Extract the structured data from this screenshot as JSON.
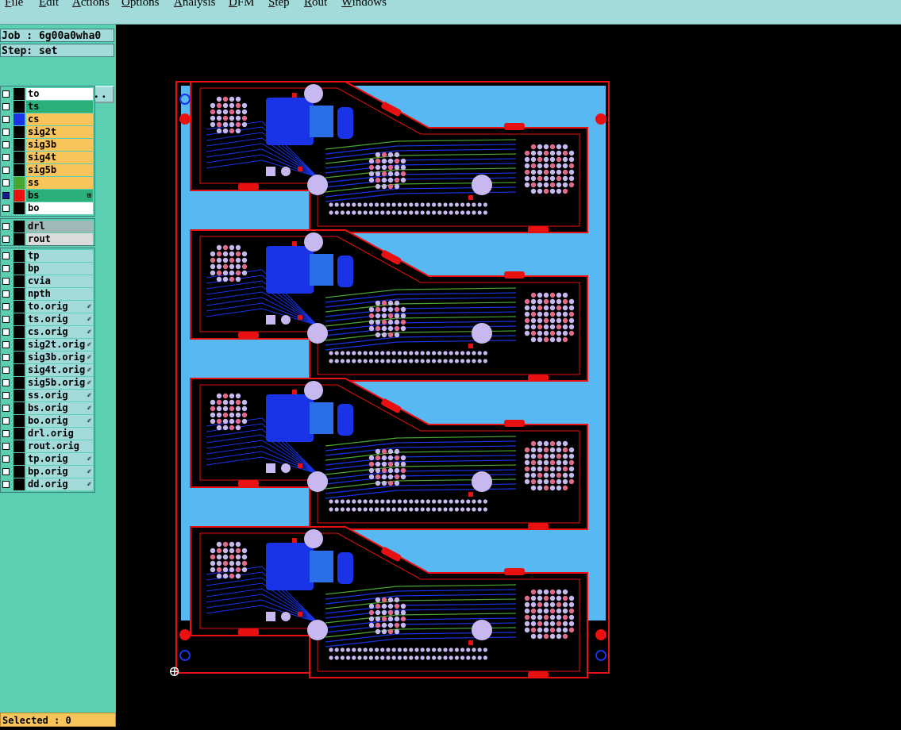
{
  "menu": [
    "File",
    "Edit",
    "Actions",
    "Options",
    "Analysis",
    "DFM",
    "Step",
    "Rout",
    "Windows"
  ],
  "job_label": "Job : 6g00a0wha0",
  "step_label": "Step: set",
  "job_matrix_button": "Job Matrix ...",
  "layers_main": [
    {
      "name": "to",
      "bg": "#ffffff",
      "swatch": "#000000",
      "mark": ""
    },
    {
      "name": "ts",
      "bg": "#2bb07a",
      "swatch": "#000000",
      "mark": ""
    },
    {
      "name": "cs",
      "bg": "#f9c45a",
      "swatch": "#1a33e6",
      "mark": ""
    },
    {
      "name": "sig2t",
      "bg": "#f9c45a",
      "swatch": "#000000",
      "mark": ""
    },
    {
      "name": "sig3b",
      "bg": "#f9c45a",
      "swatch": "#000000",
      "mark": ""
    },
    {
      "name": "sig4t",
      "bg": "#f9c45a",
      "swatch": "#000000",
      "mark": ""
    },
    {
      "name": "sig5b",
      "bg": "#f9c45a",
      "swatch": "#000000",
      "mark": ""
    },
    {
      "name": "ss",
      "bg": "#f9c45a",
      "swatch": "#47a530",
      "mark": ""
    },
    {
      "name": "bs",
      "bg": "#2bb07a",
      "swatch": "#e81010",
      "mark": "⊞"
    },
    {
      "name": "bo",
      "bg": "#ffffff",
      "swatch": "#000000",
      "mark": ""
    }
  ],
  "layers_drill": [
    {
      "name": "drl",
      "bg": "#9fb9b9",
      "swatch": "#000000",
      "mark": ""
    },
    {
      "name": "rout",
      "bg": "#dcdcdc",
      "swatch": "#000000",
      "mark": ""
    }
  ],
  "layers_misc": [
    {
      "name": "tp",
      "bg": "#a3dada",
      "swatch": "#000000",
      "mark": ""
    },
    {
      "name": "bp",
      "bg": "#a3dada",
      "swatch": "#000000",
      "mark": ""
    },
    {
      "name": "cvia",
      "bg": "#a3dada",
      "swatch": "#000000",
      "mark": ""
    },
    {
      "name": "npth",
      "bg": "#a3dada",
      "swatch": "#000000",
      "mark": ""
    },
    {
      "name": "to.orig",
      "bg": "#a3dada",
      "swatch": "#000000",
      "mark": "✐"
    },
    {
      "name": "ts.orig",
      "bg": "#a3dada",
      "swatch": "#000000",
      "mark": "✐"
    },
    {
      "name": "cs.orig",
      "bg": "#a3dada",
      "swatch": "#000000",
      "mark": "✐"
    },
    {
      "name": "sig2t.orig",
      "bg": "#a3dada",
      "swatch": "#000000",
      "mark": "✐"
    },
    {
      "name": "sig3b.orig",
      "bg": "#a3dada",
      "swatch": "#000000",
      "mark": "✐"
    },
    {
      "name": "sig4t.orig",
      "bg": "#a3dada",
      "swatch": "#000000",
      "mark": "✐"
    },
    {
      "name": "sig5b.orig",
      "bg": "#a3dada",
      "swatch": "#000000",
      "mark": "✐"
    },
    {
      "name": "ss.orig",
      "bg": "#a3dada",
      "swatch": "#000000",
      "mark": "✐"
    },
    {
      "name": "bs.orig",
      "bg": "#a3dada",
      "swatch": "#000000",
      "mark": "✐"
    },
    {
      "name": "bo.orig",
      "bg": "#a3dada",
      "swatch": "#000000",
      "mark": "✐"
    },
    {
      "name": "drl.orig",
      "bg": "#a3dada",
      "swatch": "#000000",
      "mark": ""
    },
    {
      "name": "rout.orig",
      "bg": "#a3dada",
      "swatch": "#000000",
      "mark": ""
    },
    {
      "name": "tp.orig",
      "bg": "#a3dada",
      "swatch": "#000000",
      "mark": "✐"
    },
    {
      "name": "bp.orig",
      "bg": "#a3dada",
      "swatch": "#000000",
      "mark": "✐"
    },
    {
      "name": "dd.orig",
      "bg": "#a3dada",
      "swatch": "#000000",
      "mark": "✐"
    }
  ],
  "selected_label": "Selected : 0",
  "colors": {
    "board_fill": "#58b8f2",
    "outline": "#e81010",
    "trace_blue": "#1a33e6",
    "trace_green": "#47a530",
    "pad": "#c7b9f0",
    "tab": "#e81010"
  }
}
